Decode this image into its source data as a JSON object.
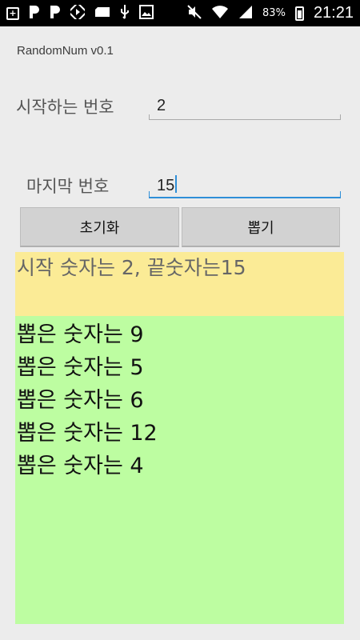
{
  "status_bar": {
    "battery": "83%",
    "time": "21:21",
    "left_icons": [
      "plus-box-icon",
      "p-notification-icon",
      "p-notification-icon",
      "play-icon",
      "sd-card-icon",
      "usb-icon",
      "image-icon"
    ],
    "right_icons": [
      "mute-icon",
      "wifi-icon",
      "signal-icon",
      "battery-charging-icon"
    ]
  },
  "app": {
    "title": "RandomNum v0.1"
  },
  "form": {
    "start_label": "시작하는 번호",
    "start_value": "2",
    "end_label": "마지막 번호",
    "end_value": "15"
  },
  "buttons": {
    "reset_label": "초기화",
    "draw_label": "뽑기"
  },
  "summary": {
    "text": "시작 숫자는 2, 끝숫자는15"
  },
  "results": [
    "뽑은 숫자는 9",
    "뽑은 숫자는 5",
    "뽑은 숫자는 6",
    "뽑은 숫자는 12",
    "뽑은 숫자는 4"
  ],
  "colors": {
    "summary_bg": "#fbeb96",
    "results_bg": "#bdfda1",
    "focus_accent": "#2f8fd8"
  }
}
